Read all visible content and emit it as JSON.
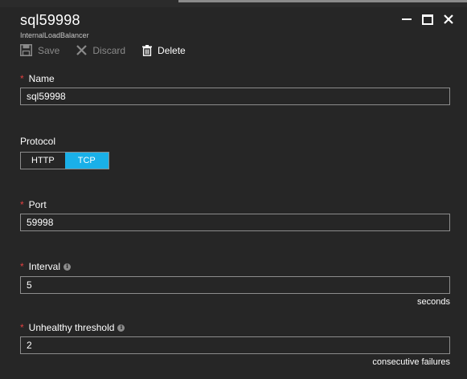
{
  "window": {
    "title": "sql59998",
    "subtitle": "InternalLoadBalancer"
  },
  "toolbar": {
    "save_label": "Save",
    "discard_label": "Discard",
    "delete_label": "Delete"
  },
  "form": {
    "name": {
      "label": "Name",
      "value": "sql59998",
      "required": true
    },
    "protocol": {
      "label": "Protocol",
      "options": [
        "HTTP",
        "TCP"
      ],
      "selected": "TCP"
    },
    "port": {
      "label": "Port",
      "value": "59998",
      "required": true
    },
    "interval": {
      "label": "Interval",
      "value": "5",
      "unit": "seconds",
      "required": true
    },
    "unhealthy": {
      "label": "Unhealthy threshold",
      "value": "2",
      "unit": "consecutive failures",
      "required": true
    }
  },
  "required_marker": "*",
  "colors": {
    "background": "#262626",
    "accent": "#1ab0e8",
    "required": "#e04040",
    "border": "#8c8c8c"
  }
}
